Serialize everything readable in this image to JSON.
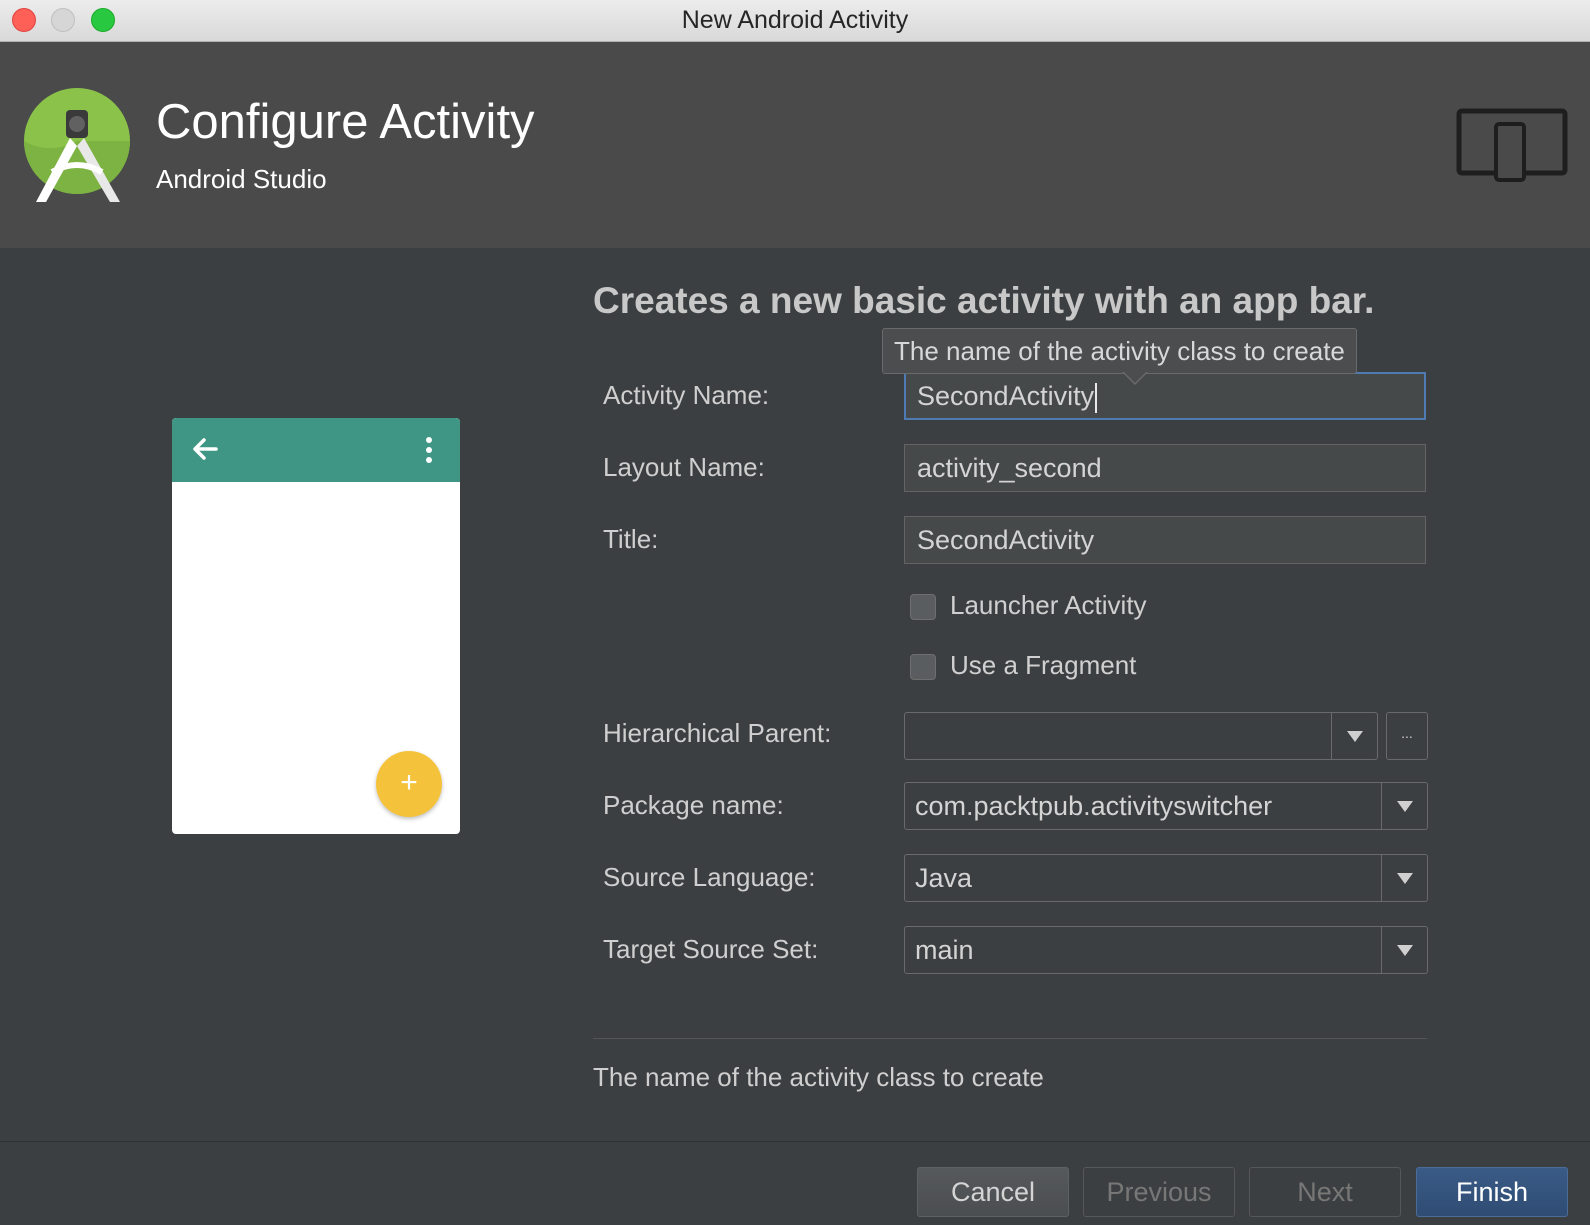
{
  "window": {
    "title": "New Android Activity"
  },
  "header": {
    "title": "Configure Activity",
    "subtitle": "Android Studio",
    "logo_icon": "android-studio-logo-icon",
    "device_icon": "tablet-phone-icon"
  },
  "form": {
    "description": "Creates a new basic activity with an app bar.",
    "tooltip": "The name of the activity class to create",
    "activity_name": {
      "label": "Activity Name:",
      "value": "SecondActivity"
    },
    "layout_name": {
      "label": "Layout Name:",
      "value": "activity_second"
    },
    "title_field": {
      "label": "Title:",
      "value": "SecondActivity"
    },
    "launcher_activity": {
      "label": "Launcher Activity",
      "checked": false
    },
    "use_fragment": {
      "label": "Use a Fragment",
      "checked": false
    },
    "hierarchical_parent": {
      "label": "Hierarchical Parent:",
      "value": "",
      "browse_label": "..."
    },
    "package_name": {
      "label": "Package name:",
      "value": "com.packtpub.activityswitcher"
    },
    "source_language": {
      "label": "Source Language:",
      "value": "Java"
    },
    "target_source_set": {
      "label": "Target Source Set:",
      "value": "main"
    },
    "help_text": "The name of the activity class to create"
  },
  "preview": {
    "appbar_color": "#3f9685",
    "fab_color": "#f5c33b",
    "fab_label": "+"
  },
  "buttons": {
    "cancel": "Cancel",
    "previous": "Previous",
    "next": "Next",
    "finish": "Finish"
  }
}
